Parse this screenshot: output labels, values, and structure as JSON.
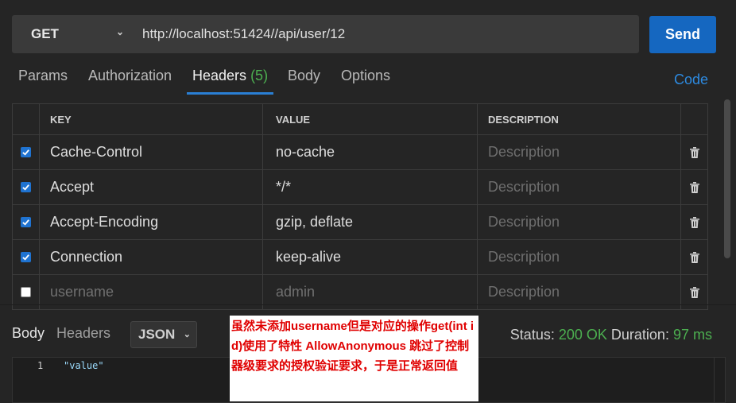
{
  "request": {
    "method": "GET",
    "url": "http://localhost:51424//api/user/12",
    "send_label": "Send"
  },
  "tabs": {
    "items": [
      {
        "label": "Params"
      },
      {
        "label": "Authorization"
      },
      {
        "label": "Headers",
        "count": "(5)"
      },
      {
        "label": "Body"
      },
      {
        "label": "Options"
      }
    ],
    "active": "Headers",
    "code_label": "Code"
  },
  "headers_table": {
    "columns": [
      "KEY",
      "VALUE",
      "DESCRIPTION"
    ],
    "rows": [
      {
        "enabled": true,
        "key": "Cache-Control",
        "value": "no-cache",
        "description_placeholder": "Description"
      },
      {
        "enabled": true,
        "key": "Accept",
        "value": "*/*",
        "description_placeholder": "Description"
      },
      {
        "enabled": true,
        "key": "Accept-Encoding",
        "value": "gzip, deflate",
        "description_placeholder": "Description"
      },
      {
        "enabled": true,
        "key": "Connection",
        "value": "keep-alive",
        "description_placeholder": "Description"
      },
      {
        "enabled": false,
        "key": "username",
        "value": "admin",
        "description_placeholder": "Description"
      }
    ]
  },
  "response": {
    "tabs": [
      "Body",
      "Headers"
    ],
    "format": "JSON",
    "status_label": "Status:",
    "status_value": "200 OK",
    "duration_label": "Duration:",
    "duration_value": "97 ms",
    "lines": [
      {
        "number": "1",
        "text": "\"value\""
      }
    ]
  },
  "annotation": {
    "text": "虽然未添加username但是对应的操作get(int id)使用了特性  AllowAnonymous  跳过了控制器级要求的授权验证要求，于是正常返回值"
  },
  "colors": {
    "accent": "#1567c0",
    "success": "#4caf50",
    "annotation_text": "#e00000"
  }
}
